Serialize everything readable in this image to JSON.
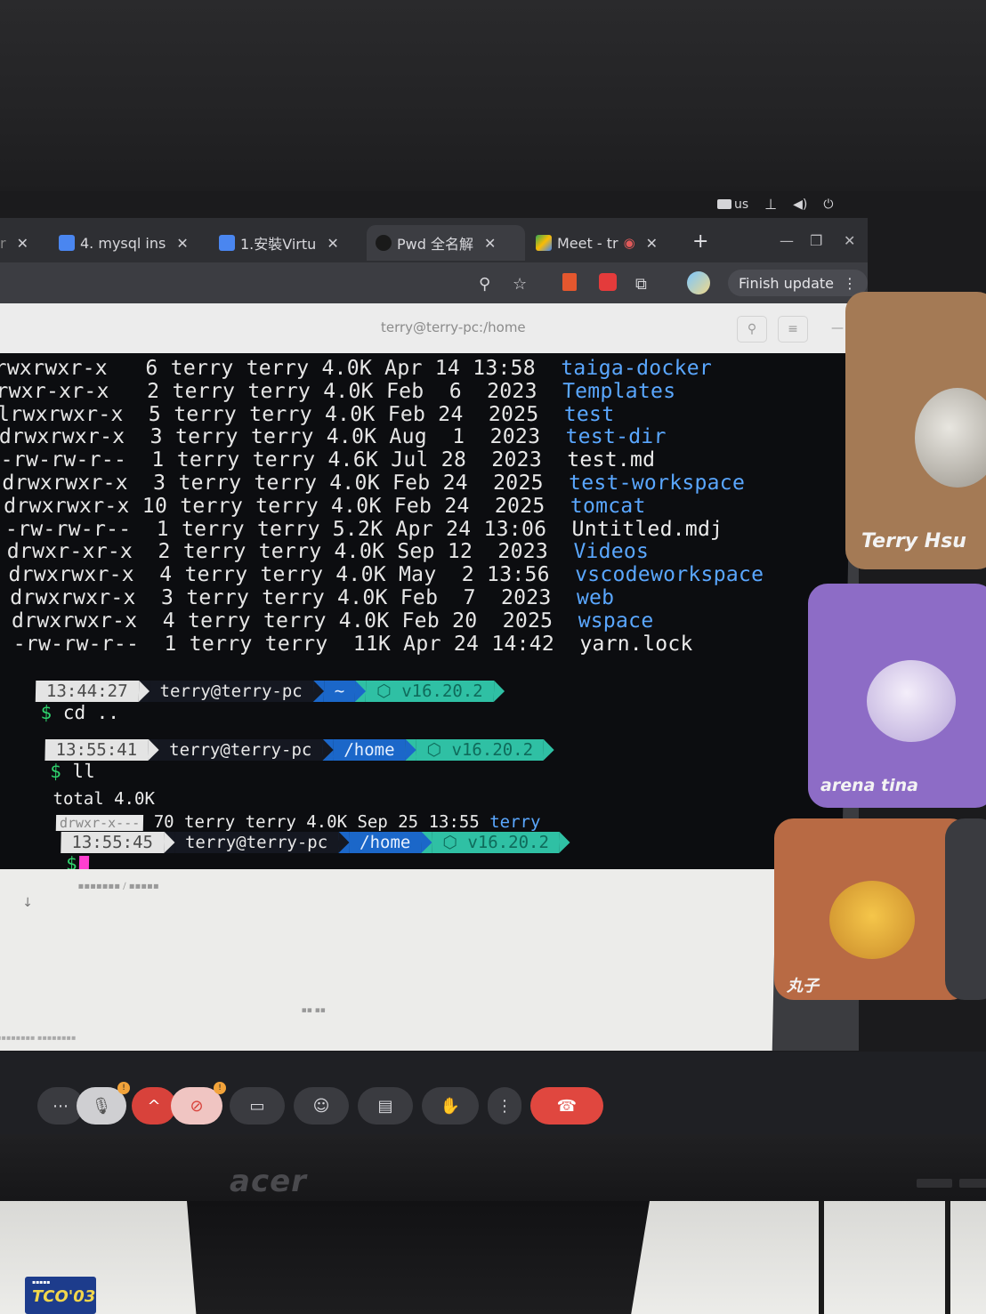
{
  "system_tray": {
    "keyboard_layout": "us"
  },
  "browser": {
    "tabs": [
      {
        "label": "4. mysql ins",
        "icon": "docs-icon",
        "color": "#4a86f0"
      },
      {
        "label": "1.安裝Virtu",
        "icon": "docs-icon",
        "color": "#4a86f0"
      },
      {
        "label": "Pwd 全名解",
        "icon": "circle-icon",
        "color": "#1a1a1a",
        "active": true
      },
      {
        "label": "Meet - tr",
        "icon": "meet-icon",
        "color": "#34a853"
      }
    ],
    "update_button": "Finish update"
  },
  "terminal": {
    "title": "terry@terry-pc:/home",
    "listing": [
      {
        "perm": "rwxrwxr-x",
        "links": "6",
        "owner": "terry",
        "group": "terry",
        "size": "4.0K",
        "month": "Apr",
        "day": "14",
        "time": "13:58",
        "name": "taiga-docker",
        "is_dir": true
      },
      {
        "perm": "rwxr-xr-x",
        "links": "2",
        "owner": "terry",
        "group": "terry",
        "size": "4.0K",
        "month": "Feb",
        "day": "6",
        "time": "2023",
        "name": "Templates",
        "is_dir": true
      },
      {
        "perm": "lrwxrwxr-x",
        "links": "5",
        "owner": "terry",
        "group": "terry",
        "size": "4.0K",
        "month": "Feb",
        "day": "24",
        "time": "2025",
        "name": "test",
        "is_dir": true
      },
      {
        "perm": "drwxrwxr-x",
        "links": "3",
        "owner": "terry",
        "group": "terry",
        "size": "4.0K",
        "month": "Aug",
        "day": "1",
        "time": "2023",
        "name": "test-dir",
        "is_dir": true
      },
      {
        "perm": "-rw-rw-r--",
        "links": "1",
        "owner": "terry",
        "group": "terry",
        "size": "4.6K",
        "month": "Jul",
        "day": "28",
        "time": "2023",
        "name": "test.md",
        "is_dir": false
      },
      {
        "perm": "drwxrwxr-x",
        "links": "3",
        "owner": "terry",
        "group": "terry",
        "size": "4.0K",
        "month": "Feb",
        "day": "24",
        "time": "2025",
        "name": "test-workspace",
        "is_dir": true
      },
      {
        "perm": "drwxrwxr-x",
        "links": "10",
        "owner": "terry",
        "group": "terry",
        "size": "4.0K",
        "month": "Feb",
        "day": "24",
        "time": "2025",
        "name": "tomcat",
        "is_dir": true
      },
      {
        "perm": "-rw-rw-r--",
        "links": "1",
        "owner": "terry",
        "group": "terry",
        "size": "5.2K",
        "month": "Apr",
        "day": "24",
        "time": "13:06",
        "name": "Untitled.mdj",
        "is_dir": false
      },
      {
        "perm": "drwxr-xr-x",
        "links": "2",
        "owner": "terry",
        "group": "terry",
        "size": "4.0K",
        "month": "Sep",
        "day": "12",
        "time": "2023",
        "name": "Videos",
        "is_dir": true
      },
      {
        "perm": "drwxrwxr-x",
        "links": "4",
        "owner": "terry",
        "group": "terry",
        "size": "4.0K",
        "month": "May",
        "day": "2",
        "time": "13:56",
        "name": "vscodeworkspace",
        "is_dir": true
      },
      {
        "perm": "drwxrwxr-x",
        "links": "3",
        "owner": "terry",
        "group": "terry",
        "size": "4.0K",
        "month": "Feb",
        "day": "7",
        "time": "2023",
        "name": "web",
        "is_dir": true
      },
      {
        "perm": "drwxrwxr-x",
        "links": "4",
        "owner": "terry",
        "group": "terry",
        "size": "4.0K",
        "month": "Feb",
        "day": "20",
        "time": "2025",
        "name": "wspace",
        "is_dir": true
      },
      {
        "perm": "-rw-rw-r--",
        "links": "1",
        "owner": "terry",
        "group": "terry",
        "size": "11K",
        "month": "Apr",
        "day": "24",
        "time": "14:42",
        "name": "yarn.lock",
        "is_dir": false
      }
    ],
    "prompts": [
      {
        "time": "13:44:27",
        "host": "terry@terry-pc",
        "dir": "~",
        "node": "v16.20.2",
        "command": "cd .."
      },
      {
        "time": "13:55:41",
        "host": "terry@terry-pc",
        "dir": "/home",
        "node": "v16.20.2",
        "command": "ll"
      },
      {
        "time": "13:55:45",
        "host": "terry@terry-pc",
        "dir": "/home",
        "node": "v16.20.2",
        "command": ""
      }
    ],
    "ll_output": {
      "total": "total 4.0K",
      "perm": "drwxr-x---",
      "rest": "70 terry terry 4.0K Sep 25 13:55",
      "name": "terry"
    },
    "dollar": "$"
  },
  "participants": [
    {
      "name": "Terry Hsu",
      "bg": "#a47a55"
    },
    {
      "name": "arena tina",
      "bg": "#8d6cc6"
    },
    {
      "name": "丸子",
      "bg": "#b86a44"
    }
  ],
  "monitor": {
    "brand": "acer",
    "sticker": "TCO'03"
  }
}
